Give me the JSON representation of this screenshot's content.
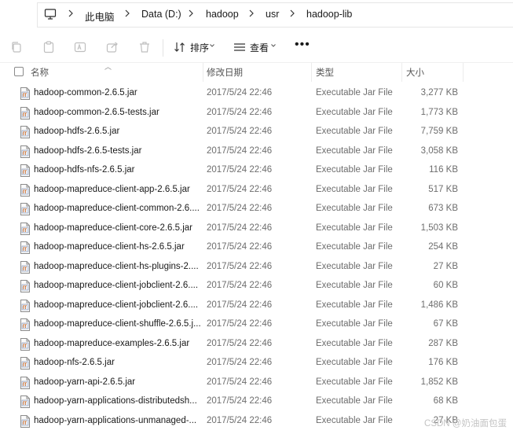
{
  "breadcrumb": {
    "items": [
      "此电脑",
      "Data (D:)",
      "hadoop",
      "usr",
      "hadoop-lib"
    ]
  },
  "toolbar": {
    "sort_label": "排序",
    "view_label": "查看",
    "more_label": "•••"
  },
  "columns": {
    "name": "名称",
    "date": "修改日期",
    "type": "类型",
    "size": "大小"
  },
  "files": [
    {
      "name": "hadoop-common-2.6.5.jar",
      "date": "2017/5/24 22:46",
      "type": "Executable Jar File",
      "size": "3,277 KB"
    },
    {
      "name": "hadoop-common-2.6.5-tests.jar",
      "date": "2017/5/24 22:46",
      "type": "Executable Jar File",
      "size": "1,773 KB"
    },
    {
      "name": "hadoop-hdfs-2.6.5.jar",
      "date": "2017/5/24 22:46",
      "type": "Executable Jar File",
      "size": "7,759 KB"
    },
    {
      "name": "hadoop-hdfs-2.6.5-tests.jar",
      "date": "2017/5/24 22:46",
      "type": "Executable Jar File",
      "size": "3,058 KB"
    },
    {
      "name": "hadoop-hdfs-nfs-2.6.5.jar",
      "date": "2017/5/24 22:46",
      "type": "Executable Jar File",
      "size": "116 KB"
    },
    {
      "name": "hadoop-mapreduce-client-app-2.6.5.jar",
      "date": "2017/5/24 22:46",
      "type": "Executable Jar File",
      "size": "517 KB"
    },
    {
      "name": "hadoop-mapreduce-client-common-2.6....",
      "date": "2017/5/24 22:46",
      "type": "Executable Jar File",
      "size": "673 KB"
    },
    {
      "name": "hadoop-mapreduce-client-core-2.6.5.jar",
      "date": "2017/5/24 22:46",
      "type": "Executable Jar File",
      "size": "1,503 KB"
    },
    {
      "name": "hadoop-mapreduce-client-hs-2.6.5.jar",
      "date": "2017/5/24 22:46",
      "type": "Executable Jar File",
      "size": "254 KB"
    },
    {
      "name": "hadoop-mapreduce-client-hs-plugins-2....",
      "date": "2017/5/24 22:46",
      "type": "Executable Jar File",
      "size": "27 KB"
    },
    {
      "name": "hadoop-mapreduce-client-jobclient-2.6....",
      "date": "2017/5/24 22:46",
      "type": "Executable Jar File",
      "size": "60 KB"
    },
    {
      "name": "hadoop-mapreduce-client-jobclient-2.6....",
      "date": "2017/5/24 22:46",
      "type": "Executable Jar File",
      "size": "1,486 KB"
    },
    {
      "name": "hadoop-mapreduce-client-shuffle-2.6.5.j...",
      "date": "2017/5/24 22:46",
      "type": "Executable Jar File",
      "size": "67 KB"
    },
    {
      "name": "hadoop-mapreduce-examples-2.6.5.jar",
      "date": "2017/5/24 22:46",
      "type": "Executable Jar File",
      "size": "287 KB"
    },
    {
      "name": "hadoop-nfs-2.6.5.jar",
      "date": "2017/5/24 22:46",
      "type": "Executable Jar File",
      "size": "176 KB"
    },
    {
      "name": "hadoop-yarn-api-2.6.5.jar",
      "date": "2017/5/24 22:46",
      "type": "Executable Jar File",
      "size": "1,852 KB"
    },
    {
      "name": "hadoop-yarn-applications-distributedsh...",
      "date": "2017/5/24 22:46",
      "type": "Executable Jar File",
      "size": "68 KB"
    },
    {
      "name": "hadoop-yarn-applications-unmanaged-...",
      "date": "2017/5/24 22:46",
      "type": "Executable Jar File",
      "size": "27 KB"
    }
  ],
  "watermark": "CSDN @奶油面包蛋"
}
